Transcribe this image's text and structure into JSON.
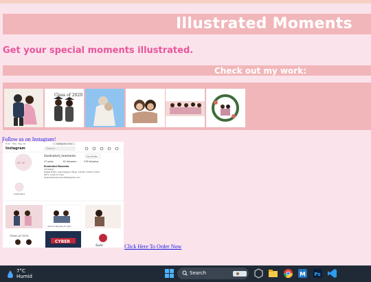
{
  "page": {
    "title": "Illustrated Moments",
    "tagline": "Get your special moments illustrated.",
    "work_heading": "Check out my work:",
    "instagram_link": "Follow us on Instagram!",
    "order_link": "Click Here To Order Now"
  },
  "gallery": [
    {
      "name": "couple-dancing-illustration"
    },
    {
      "name": "graduation-couple-illustration",
      "caption": "Class of 2020"
    },
    {
      "name": "kiss-on-forehead-illustration"
    },
    {
      "name": "mother-daughter-illustration"
    },
    {
      "name": "family-group-illustration"
    },
    {
      "name": "floral-wreath-couple-illustration"
    }
  ],
  "instagram_preview": {
    "time": "9:41",
    "date": "Mon, May 10",
    "url": "instagram.com",
    "brand": "Instagram",
    "search_placeholder": "Search",
    "username": "illustrated_moments",
    "follow_label": "Edit Profile",
    "stats": {
      "posts": "47 posts",
      "followers": "61 followers",
      "following": "278 following"
    },
    "bio_name": "Illustrated Moments",
    "bio_lines": [
      "Art Design",
      "Digital Prints, Logo Designs, Mugs, T-shirts, Custom Cards",
      "DM or email to order",
      "illustratedmoments.2020@gmail.com"
    ],
    "highlight_label": "Customers",
    "posts": [
      {
        "name": "post-couple"
      },
      {
        "name": "post-couple-caption",
        "caption": "when N Peeples for life?"
      },
      {
        "name": "post-portrait"
      },
      {
        "name": "post-class-of-2020",
        "caption": "Class of 2020"
      },
      {
        "name": "post-cyber",
        "caption": "CYBER"
      },
      {
        "name": "post-sale",
        "caption": "Sale"
      }
    ]
  },
  "taskbar": {
    "temperature": "7°C",
    "weather_label": "Humid",
    "search_label": "Search"
  },
  "colors": {
    "background": "#fbe3ec",
    "bar": "#f1b6b9",
    "tagline": "#e8559a",
    "link": "#1d1de0",
    "taskbar": "#202a36"
  }
}
